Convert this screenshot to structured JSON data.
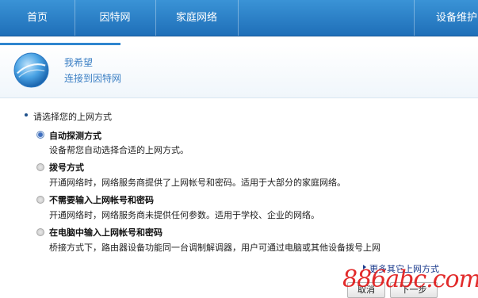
{
  "nav": {
    "items": [
      "首页",
      "因特网",
      "家庭网络",
      "设备维护"
    ]
  },
  "header": {
    "title": "我希望",
    "subtitle": "连接到因特网"
  },
  "content": {
    "section_title": "请选择您的上网方式",
    "options": [
      {
        "title": "自动探测方式",
        "desc": "设备帮您自动选择合适的上网方式。",
        "selected": true
      },
      {
        "title": "拨号方式",
        "desc": "开通网络时，网络服务商提供了上网帐号和密码。适用于大部分的家庭网络。",
        "selected": false
      },
      {
        "title": "不需要输入上网帐号和密码",
        "desc": "开通网络时，网络服务商未提供任何参数。适用于学校、企业的网络。",
        "selected": false
      },
      {
        "title": "在电脑中输入上网帐号和密码",
        "desc": "桥接方式下，路由器设备功能同一台调制解调器，用户可通过电脑或其他设备拨号上网",
        "selected": false
      }
    ],
    "more_link": "更多其它上网方式"
  },
  "buttons": {
    "cancel": "取消",
    "next": "下一步"
  },
  "watermark": "886abc.com",
  "colors": {
    "nav_bg": "#2a80c8",
    "accent_text": "#3b7fc4",
    "watermark": "#e01a1a"
  }
}
